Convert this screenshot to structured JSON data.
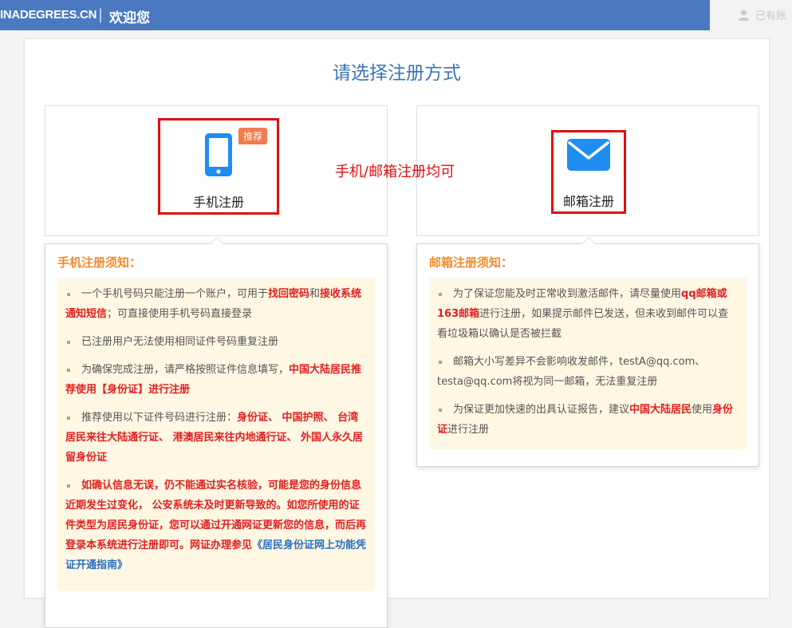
{
  "header": {
    "brand": "INADEGREES.CN",
    "separator": "|",
    "welcome": "欢迎您",
    "user_text": "已有账"
  },
  "page": {
    "title": "请选择注册方式",
    "annotation": "手机/邮箱注册均可"
  },
  "options": {
    "phone": {
      "label": "手机注册",
      "badge": "推荐",
      "icon": "smartphone-icon"
    },
    "email": {
      "label": "邮箱注册",
      "icon": "envelope-icon"
    }
  },
  "phone_notice": {
    "title": "手机注册须知：",
    "items": {
      "1": {
        "a": "一个手机号码只能注册一个账户，可用于",
        "b": "找回密码",
        "c": "和",
        "d": "接收系统通知短信",
        "e": "；可直接使用手机号码直接登录"
      },
      "2": {
        "a": "已注册用户无法使用相同证件号码重复注册"
      },
      "3": {
        "a": "为确保完成注册，请严格按照证件信息填写，",
        "b": "中国大陆居民推荐使用【身份证】进行注册"
      },
      "4": {
        "a": "推荐使用以下证件号码进行注册：",
        "b": "身份证、 中国护照、 台湾居民来往大陆通行证、 港澳居民来往内地通行证、 外国人永久居留身份证"
      },
      "5": {
        "a": "如确认信息无误，仍不能通过实名核验，可能是您的身份信息近期发生过变化， 公安系统未及时更新导致的。如您所使用的证件类型为居民身份证，您可以通过开通网证更新您的信息，而后再登录本系统进行注册即可。网证办理参见",
        "link": "《居民身份证网上功能凭证开通指南》"
      }
    }
  },
  "email_notice": {
    "title": "邮箱注册须知：",
    "items": {
      "1": {
        "a": "为了保证您能及时正常收到激活邮件，请尽量使用",
        "b": "qq邮箱或163邮箱",
        "c": "进行注册，如果提示邮件已发送，但未收到邮件可以查看垃圾箱以确认是否被拦截"
      },
      "2": {
        "a": "邮箱大小写差异不会影响收发邮件，testA@qq.com、testa@qq.com将视为同一邮箱，无法重复注册"
      },
      "3": {
        "a": "为保证更加快速的出具认证报告，建议",
        "b": "中国大陆居民",
        "c": "使用",
        "d": "身份证",
        "e": "进行注册"
      }
    }
  },
  "colors": {
    "header_bg": "#4a79c0",
    "title_blue": "#3b75b7",
    "highlight_red": "#e0201f",
    "notice_orange": "#f08c2e",
    "notice_bg": "#fef7e4",
    "badge_orange": "#f27c4e",
    "icon_blue": "#1e8ef0"
  }
}
